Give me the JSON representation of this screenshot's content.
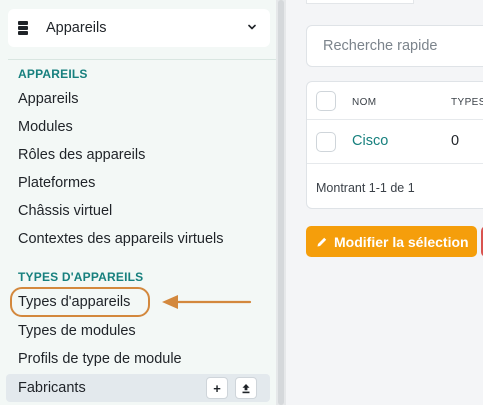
{
  "sidebar": {
    "section_title": "Appareils",
    "groups": [
      {
        "label": "APPAREILS",
        "items": [
          "Appareils",
          "Modules",
          "Rôles des appareils",
          "Plateformes",
          "Châssis virtuel",
          "Contextes des appareils virtuels"
        ]
      },
      {
        "label": "TYPES D'APPAREILS",
        "items": [
          "Types d'appareils",
          "Types de modules",
          "Profils de type de module",
          "Fabricants"
        ]
      }
    ],
    "fabricants_actions": {
      "add": "+",
      "import": "⇧"
    }
  },
  "main": {
    "search_placeholder": "Recherche rapide",
    "table": {
      "headers": [
        "NOM",
        "TYPES"
      ],
      "rows": [
        {
          "name": "Cisco",
          "types": "0"
        }
      ],
      "footer": "Montrant 1-1 de 1"
    },
    "edit_selection_label": "Modifier la sélection"
  },
  "colors": {
    "accent": "#17807e",
    "highlight": "#d3883d",
    "warning_button": "#f59e0b",
    "danger_edge": "#d9534f"
  }
}
